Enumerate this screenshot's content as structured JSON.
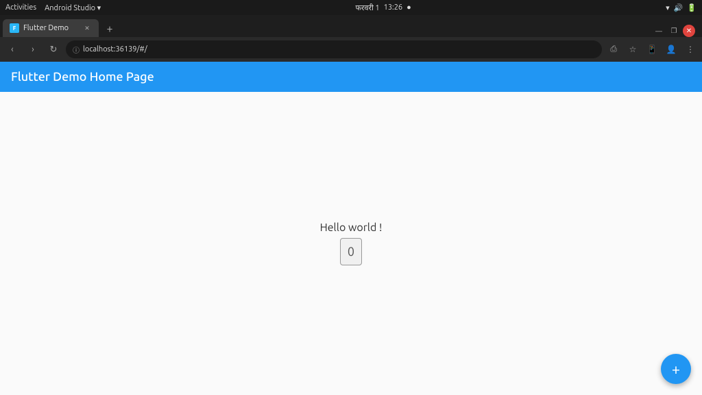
{
  "os_topbar": {
    "left": {
      "activities": "Activities",
      "android_studio": "Android Studio ▾"
    },
    "center": {
      "date": "फरवरी 1",
      "time": "13:26",
      "dot": "●"
    },
    "right": {
      "wifi": "▾",
      "volume": "🔊",
      "battery": "🔋"
    }
  },
  "browser": {
    "tab": {
      "title": "Flutter Demo",
      "favicon_letter": "F"
    },
    "tab_new_label": "+",
    "window_controls": {
      "minimize": "—",
      "maximize": "❐",
      "close": "✕"
    },
    "nav": {
      "back": "‹",
      "forward": "›",
      "reload": "↻",
      "url": "localhost:36139/#/"
    },
    "addressbar_right": {
      "share": "⎙",
      "star": "☆",
      "phone": "📱",
      "user": "👤",
      "menu": "⋮"
    }
  },
  "flutter": {
    "appbar_title": "Flutter Demo Home Page",
    "hello_text": "Hello world !",
    "counter_value": "0",
    "fab_label": "+"
  }
}
